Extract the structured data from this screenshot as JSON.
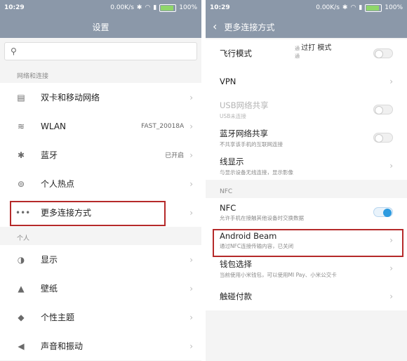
{
  "left_screen": {
    "status": {
      "time": "10:29",
      "speed": "0.00K/s",
      "battery": "100%"
    },
    "title": "设置",
    "search": {
      "placeholder": ""
    },
    "sections": [
      {
        "title": "网络和连接",
        "items": [
          {
            "label": "双卡和移动网络",
            "value": "",
            "icon": "sim-card-icon"
          },
          {
            "label": "WLAN",
            "value": "FAST_20018A",
            "icon": "wifi-icon"
          },
          {
            "label": "蓝牙",
            "value": "已开启",
            "icon": "bluetooth-icon"
          },
          {
            "label": "个人热点",
            "value": "",
            "icon": "hotspot-icon"
          },
          {
            "label": "更多连接方式",
            "value": "",
            "icon": "more-icon"
          }
        ]
      },
      {
        "title": "个人",
        "items": [
          {
            "label": "显示",
            "value": "",
            "icon": "display-icon"
          },
          {
            "label": "壁纸",
            "value": "",
            "icon": "wallpaper-icon"
          },
          {
            "label": "个性主题",
            "value": "",
            "icon": "theme-icon"
          },
          {
            "label": "声音和振动",
            "value": "",
            "icon": "sound-icon"
          }
        ]
      }
    ]
  },
  "right_screen": {
    "status": {
      "time": "10:29",
      "speed": "0.00K/s",
      "battery": "100%"
    },
    "title": "更多连接方式",
    "airplane": {
      "label": "飞行模式",
      "note_line1": "通",
      "note_emph": "过打 模式",
      "note_line2": "通"
    },
    "vpn": {
      "label": "VPN"
    },
    "usb": {
      "label": "USB网络共享",
      "sub": "USB未连接"
    },
    "bt_tether": {
      "label": "蓝牙网络共享",
      "sub": "不共享该手机的互联网连接"
    },
    "cast": {
      "label": "线显示",
      "sub": "与显示设备无线连接，显示影像"
    },
    "nfc_section": "NFC",
    "nfc": {
      "label": "NFC",
      "sub": "允许手机在接触其他设备时交换数据",
      "on": true
    },
    "android_beam": {
      "label": "Android Beam",
      "sub": "通过NFC连接传输内容，已关闭"
    },
    "wallet": {
      "label": "钱包选择",
      "sub": "当前使用小米钱包，可以使用MI Pay、小米公交卡"
    },
    "tap_pay": {
      "label": "触碰付款"
    }
  },
  "colors": {
    "header": "#8b98a9",
    "highlight_box": "#b52a2a",
    "toggle_on": "#2d9be0"
  }
}
